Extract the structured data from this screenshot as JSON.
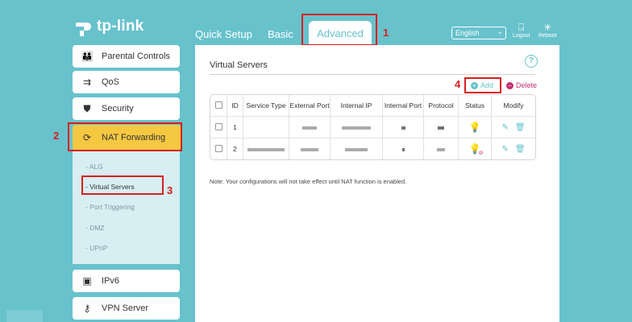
{
  "brand": {
    "logo_text": "tp-link"
  },
  "tabs": [
    {
      "label": "Quick Setup"
    },
    {
      "label": "Basic"
    },
    {
      "label": "Advanced",
      "active": true
    }
  ],
  "header": {
    "language": "English",
    "logout_label": "Logout",
    "reboot_label": "Reboot"
  },
  "annotations": {
    "n1": "1",
    "n2": "2",
    "n3": "3",
    "n4": "4"
  },
  "sidebar": {
    "items": [
      {
        "label": "Parental Controls",
        "icon": "parental-controls-icon"
      },
      {
        "label": "QoS",
        "icon": "qos-icon"
      },
      {
        "label": "Security",
        "icon": "shield-icon"
      },
      {
        "label": "NAT Forwarding",
        "icon": "nat-icon",
        "active": true
      },
      {
        "label": "IPv6",
        "icon": "ipv6-icon"
      },
      {
        "label": "VPN Server",
        "icon": "vpn-icon"
      }
    ],
    "subitems": [
      {
        "label": "- ALG"
      },
      {
        "label": "- Virtual Servers",
        "active": true
      },
      {
        "label": "- Port Triggering"
      },
      {
        "label": "- DMZ"
      },
      {
        "label": "- UPnP"
      }
    ]
  },
  "main": {
    "title": "Virtual Servers",
    "add_label": "Add",
    "delete_label": "Delete",
    "columns": [
      "ID",
      "Service Type",
      "External Port",
      "Internal IP",
      "Internal Port",
      "Protocol",
      "Status",
      "Modify"
    ],
    "rows": [
      {
        "id": "1",
        "status": "enabled"
      },
      {
        "id": "2",
        "status": "disabled"
      }
    ],
    "note": "Note: Your configurations will not take effect until NAT function is enabled."
  },
  "colors": {
    "background": "#67c2cc",
    "accent": "#67c2cc",
    "active_nav": "#f5c842",
    "highlight": "#d81e1e",
    "delete": "#c0306f"
  }
}
